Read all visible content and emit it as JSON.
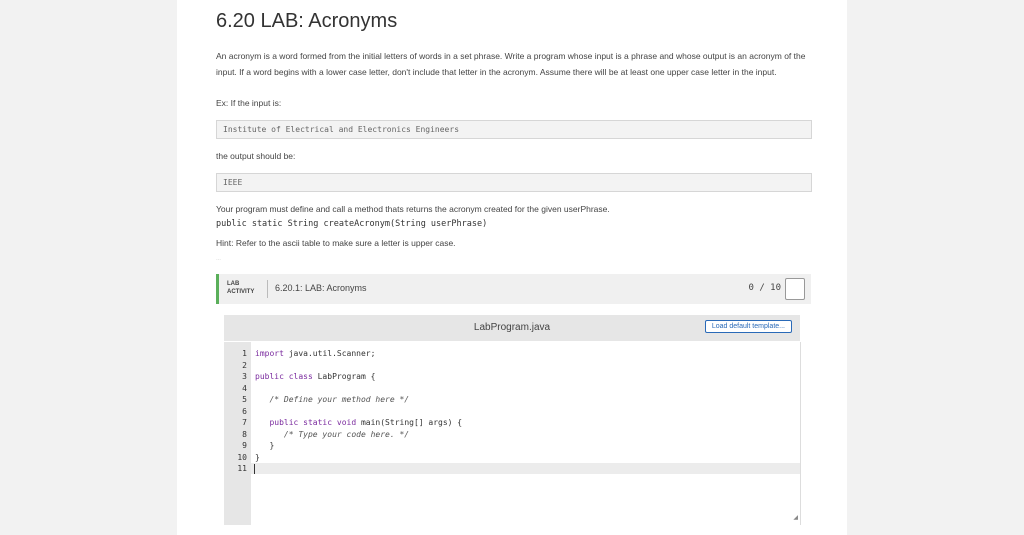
{
  "title": "6.20 LAB: Acronyms",
  "description": "An acronym is a word formed from the initial letters of words in a set phrase. Write a program whose input is a phrase and whose output is an acronym of the input. If a word begins with a lower case letter, don't include that letter in the acronym. Assume there will be at least one upper case letter in the input.",
  "example_intro": "Ex: If the input is:",
  "example_input": "Institute of Electrical and Electronics Engineers",
  "output_intro": "the output should be:",
  "example_output": "IEEE",
  "method_text": "Your program must define and call a method thats returns the acronym created for the given userPhrase.",
  "method_signature": "public static String createAcronym(String userPhrase)",
  "hint": "Hint: Refer to the ascii table to make sure a letter is upper case.",
  "credit": "…",
  "lab": {
    "tag_line1": "LAB",
    "tag_line2": "ACTIVITY",
    "title": "6.20.1: LAB: Acronyms",
    "score": "0 / 10"
  },
  "ide": {
    "filename": "LabProgram.java",
    "load_button": "Load default template...",
    "line_numbers": [
      "1",
      "2",
      "3",
      "4",
      "5",
      "6",
      "7",
      "8",
      "9",
      "10",
      "11"
    ],
    "lines": {
      "l1_kw": "import",
      "l1_rest": " java.util.Scanner;",
      "l3_kw": "public class",
      "l3_rest": " LabProgram {",
      "l5": "   /* Define your method here */",
      "l7_kw": "   public static void",
      "l7_rest": " main(String[] args) {",
      "l8": "      /* Type your code here. */",
      "l9": "   }",
      "l10": "}"
    }
  }
}
